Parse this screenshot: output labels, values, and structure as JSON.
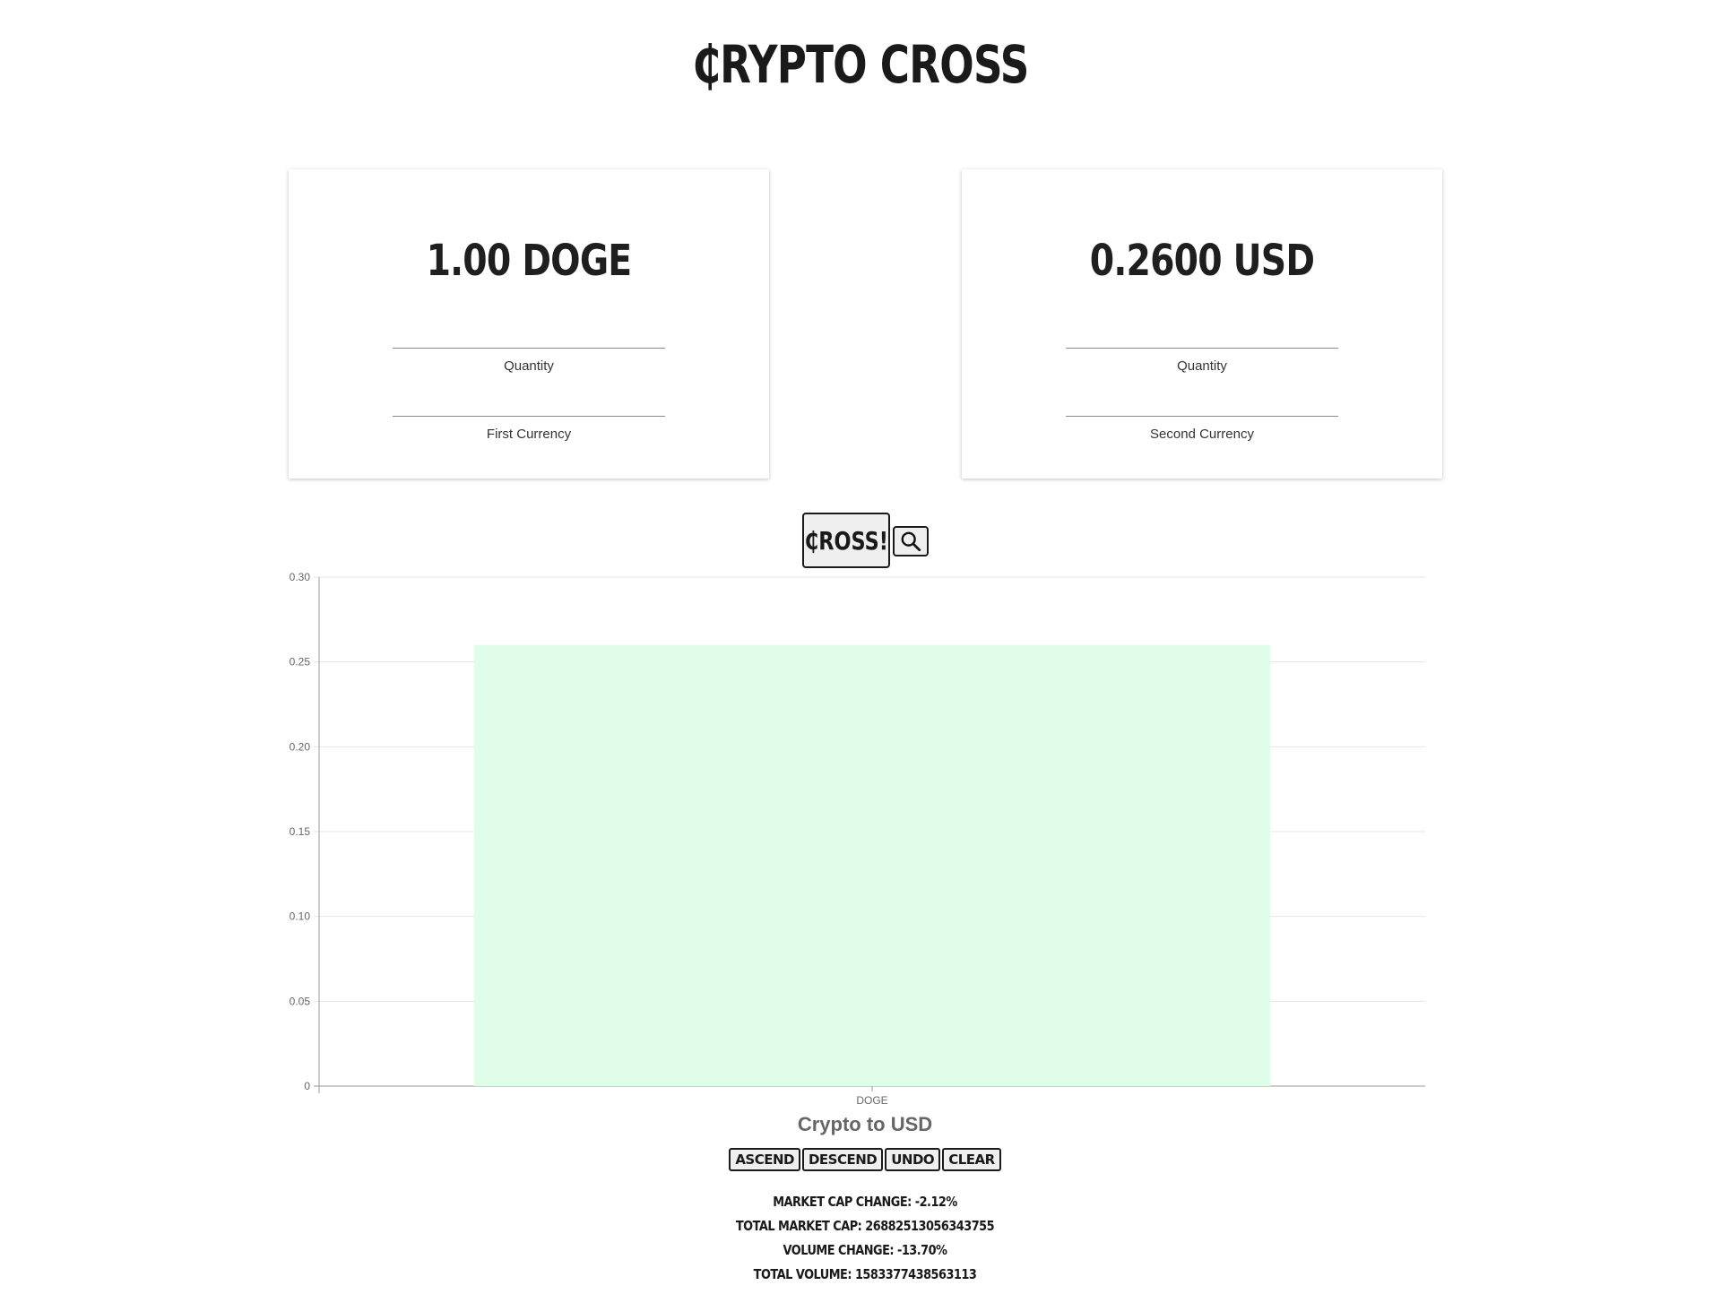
{
  "app": {
    "title": "₵RYPTO CROSS"
  },
  "cards": {
    "first": {
      "display": "1.00 DOGE",
      "quantity_label": "Quantity",
      "currency_label": "First Currency"
    },
    "second": {
      "display": "0.2600 USD",
      "quantity_label": "Quantity",
      "currency_label": "Second Currency"
    }
  },
  "actions": {
    "cross_label": "₵ROSS!",
    "search_icon": "search-icon"
  },
  "chart_data": {
    "type": "bar",
    "categories": [
      "DOGE"
    ],
    "values": [
      0.26
    ],
    "title": "Crypto to USD",
    "ylim": [
      0,
      0.3
    ],
    "yticks": [
      "0",
      "0.05",
      "0.10",
      "0.15",
      "0.20",
      "0.25",
      "0.30"
    ],
    "ytick_values": [
      0,
      0.05,
      0.1,
      0.15,
      0.2,
      0.25,
      0.3
    ],
    "bar_color": "#e0fde9",
    "grid": true
  },
  "controls": {
    "ascend": "ASCEND",
    "descend": "DESCEND",
    "undo": "UNDO",
    "clear": "CLEAR"
  },
  "stats": {
    "market_cap_change": "MARKET CAP CHANGE: -2.12%",
    "total_market_cap": "TOTAL MARKET CAP: 26882513056343755",
    "volume_change": "VOLUME CHANGE: -13.70%",
    "total_volume": "TOTAL VOLUME: 1583377438563113"
  }
}
